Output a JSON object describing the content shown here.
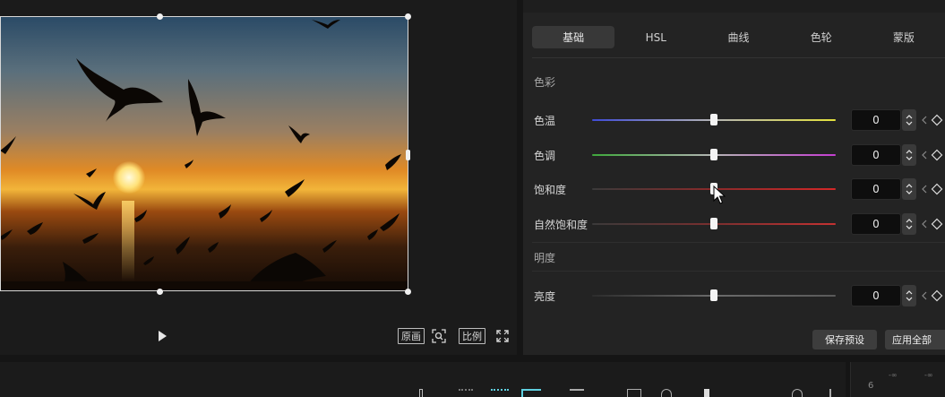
{
  "player": {
    "preview_scene": "sunset sea with flying seagulls",
    "controls": {
      "original_label": "原画",
      "ratio_label": "比例"
    }
  },
  "adjust": {
    "tabs": [
      {
        "label": "基础",
        "active": true
      },
      {
        "label": "HSL",
        "active": false
      },
      {
        "label": "曲线",
        "active": false
      },
      {
        "label": "色轮",
        "active": false
      },
      {
        "label": "蒙版",
        "active": false
      }
    ],
    "sections": {
      "color": "色彩",
      "brightness": "明度"
    },
    "sliders": [
      {
        "label": "色温",
        "value": "0",
        "position": 0.5,
        "track_gradient": [
          "#3f4bd6",
          "#b4b4b4",
          "#e4e23c"
        ]
      },
      {
        "label": "色调",
        "value": "0",
        "position": 0.5,
        "track_gradient": [
          "#3fa83c",
          "#b4b4b4",
          "#c43ed1"
        ]
      },
      {
        "label": "饱和度",
        "value": "0",
        "position": 0.5,
        "track_gradient": [
          "#3a3a3a",
          "#8a2a2a",
          "#d42828"
        ]
      },
      {
        "label": "自然饱和度",
        "value": "0",
        "position": 0.5,
        "track_gradient": [
          "#3a3a3a",
          "#7a2f2f",
          "#c43232"
        ]
      },
      {
        "label": "亮度",
        "value": "0",
        "position": 0.5,
        "track_gradient": [
          "#2c2c2c",
          "#6a6a6a",
          "#5a5a5a"
        ]
      }
    ],
    "buttons": {
      "save_preset": "保存预设",
      "apply_all": "应用全部"
    }
  },
  "timeline": {
    "ruler_mark": "6",
    "db_ticks": [
      "-∞",
      "-∞"
    ]
  },
  "colors": {
    "accent": "#5fd0e0",
    "panel_bg": "#232323",
    "player_bg": "#1b1b1b"
  }
}
